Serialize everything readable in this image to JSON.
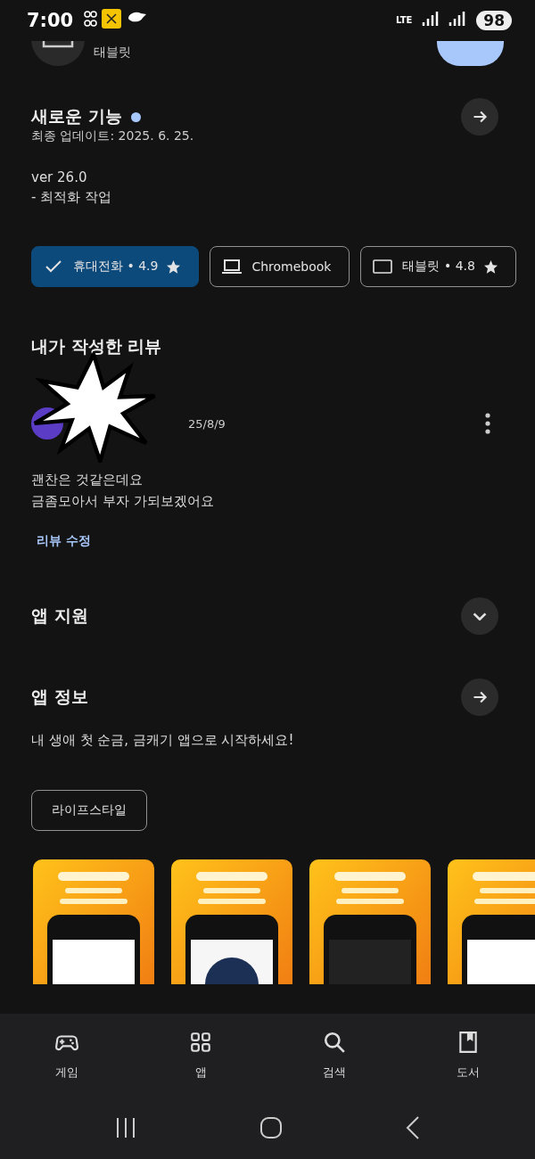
{
  "status_bar": {
    "time": "7:00",
    "network": "LTE",
    "battery": "98"
  },
  "app_header": {
    "device_label": "태블릿"
  },
  "whats_new": {
    "title": "새로운 기능",
    "unread": true,
    "updated": "최종 업데이트: 2025. 6. 25.",
    "lines": [
      "ver 26.0",
      "- 최적화 작업"
    ]
  },
  "devices": [
    {
      "label": "휴대전화 • 4.9",
      "rated": true,
      "selected": true
    },
    {
      "kind": "laptop",
      "label": "Chromebook",
      "rated": false,
      "selected": false
    },
    {
      "kind": "tablet",
      "label": "태블릿 • 4.8",
      "rated": true,
      "selected": false
    }
  ],
  "review": {
    "title": "내가 작성한 리뷰",
    "date": "25/8/9",
    "lines": [
      "괜찬은 것같은데요",
      "금좀모아서 부자 가되보겠어요"
    ],
    "edit_link": "리뷰 수정"
  },
  "sections": [
    {
      "kind": "expand",
      "title": "앱 지원"
    },
    {
      "kind": "arrow",
      "title": "앱 정보"
    }
  ],
  "app_info": {
    "description": "내 생애 첫 순금, 금캐기 앱으로 시작하세요!",
    "category": "라이프스타일"
  },
  "bottom_nav": [
    {
      "kind": "game",
      "label": "게임"
    },
    {
      "kind": "apps",
      "label": "앱"
    },
    {
      "kind": "search",
      "label": "검색"
    },
    {
      "kind": "books",
      "label": "도서"
    }
  ]
}
